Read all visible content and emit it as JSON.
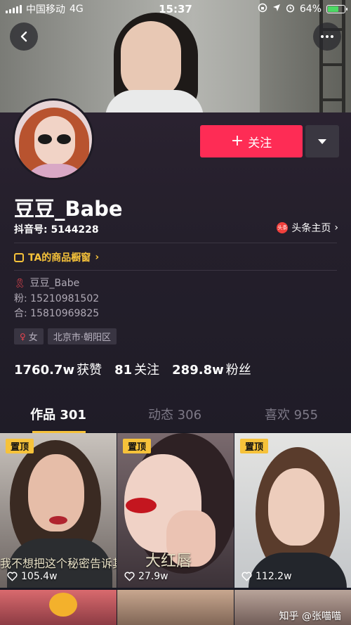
{
  "status_bar": {
    "carrier": "中国移动",
    "network": "4G",
    "time": "15:37",
    "battery": "64%",
    "battery_level": 0.64
  },
  "profile": {
    "nickname": "豆豆_Babe",
    "douyin_id": "抖音号: 5144228",
    "toutiao_badge": "头条",
    "toutiao_link": "头条主页",
    "follow_label": "关注",
    "shop_link": "TA的商品橱窗",
    "bio": [
      "豆豆_Babe",
      "粉: 15210981502",
      "合: 15810969825"
    ],
    "tags": {
      "gender": "女",
      "location": "北京市·朝阳区"
    },
    "stats": [
      {
        "num": "1760.7w",
        "label": "获赞"
      },
      {
        "num": "81",
        "label": "关注"
      },
      {
        "num": "289.8w",
        "label": "粉丝"
      }
    ]
  },
  "tabs": [
    {
      "label": "作品 301",
      "active": true
    },
    {
      "label": "动态 306",
      "active": false
    },
    {
      "label": "喜欢 955",
      "active": false
    }
  ],
  "videos": [
    {
      "pinned": "置顶",
      "likes": "105.4w",
      "caption": "我不想把这个秘密告诉其"
    },
    {
      "pinned": "置顶",
      "likes": "27.9w",
      "caption": "大红唇"
    },
    {
      "pinned": "置顶",
      "likes": "112.2w",
      "caption": ""
    }
  ],
  "watermark": "知乎 @张喵喵",
  "colors": {
    "accent": "#fe2c55",
    "highlight": "#f6c23a",
    "background": "#161823"
  }
}
